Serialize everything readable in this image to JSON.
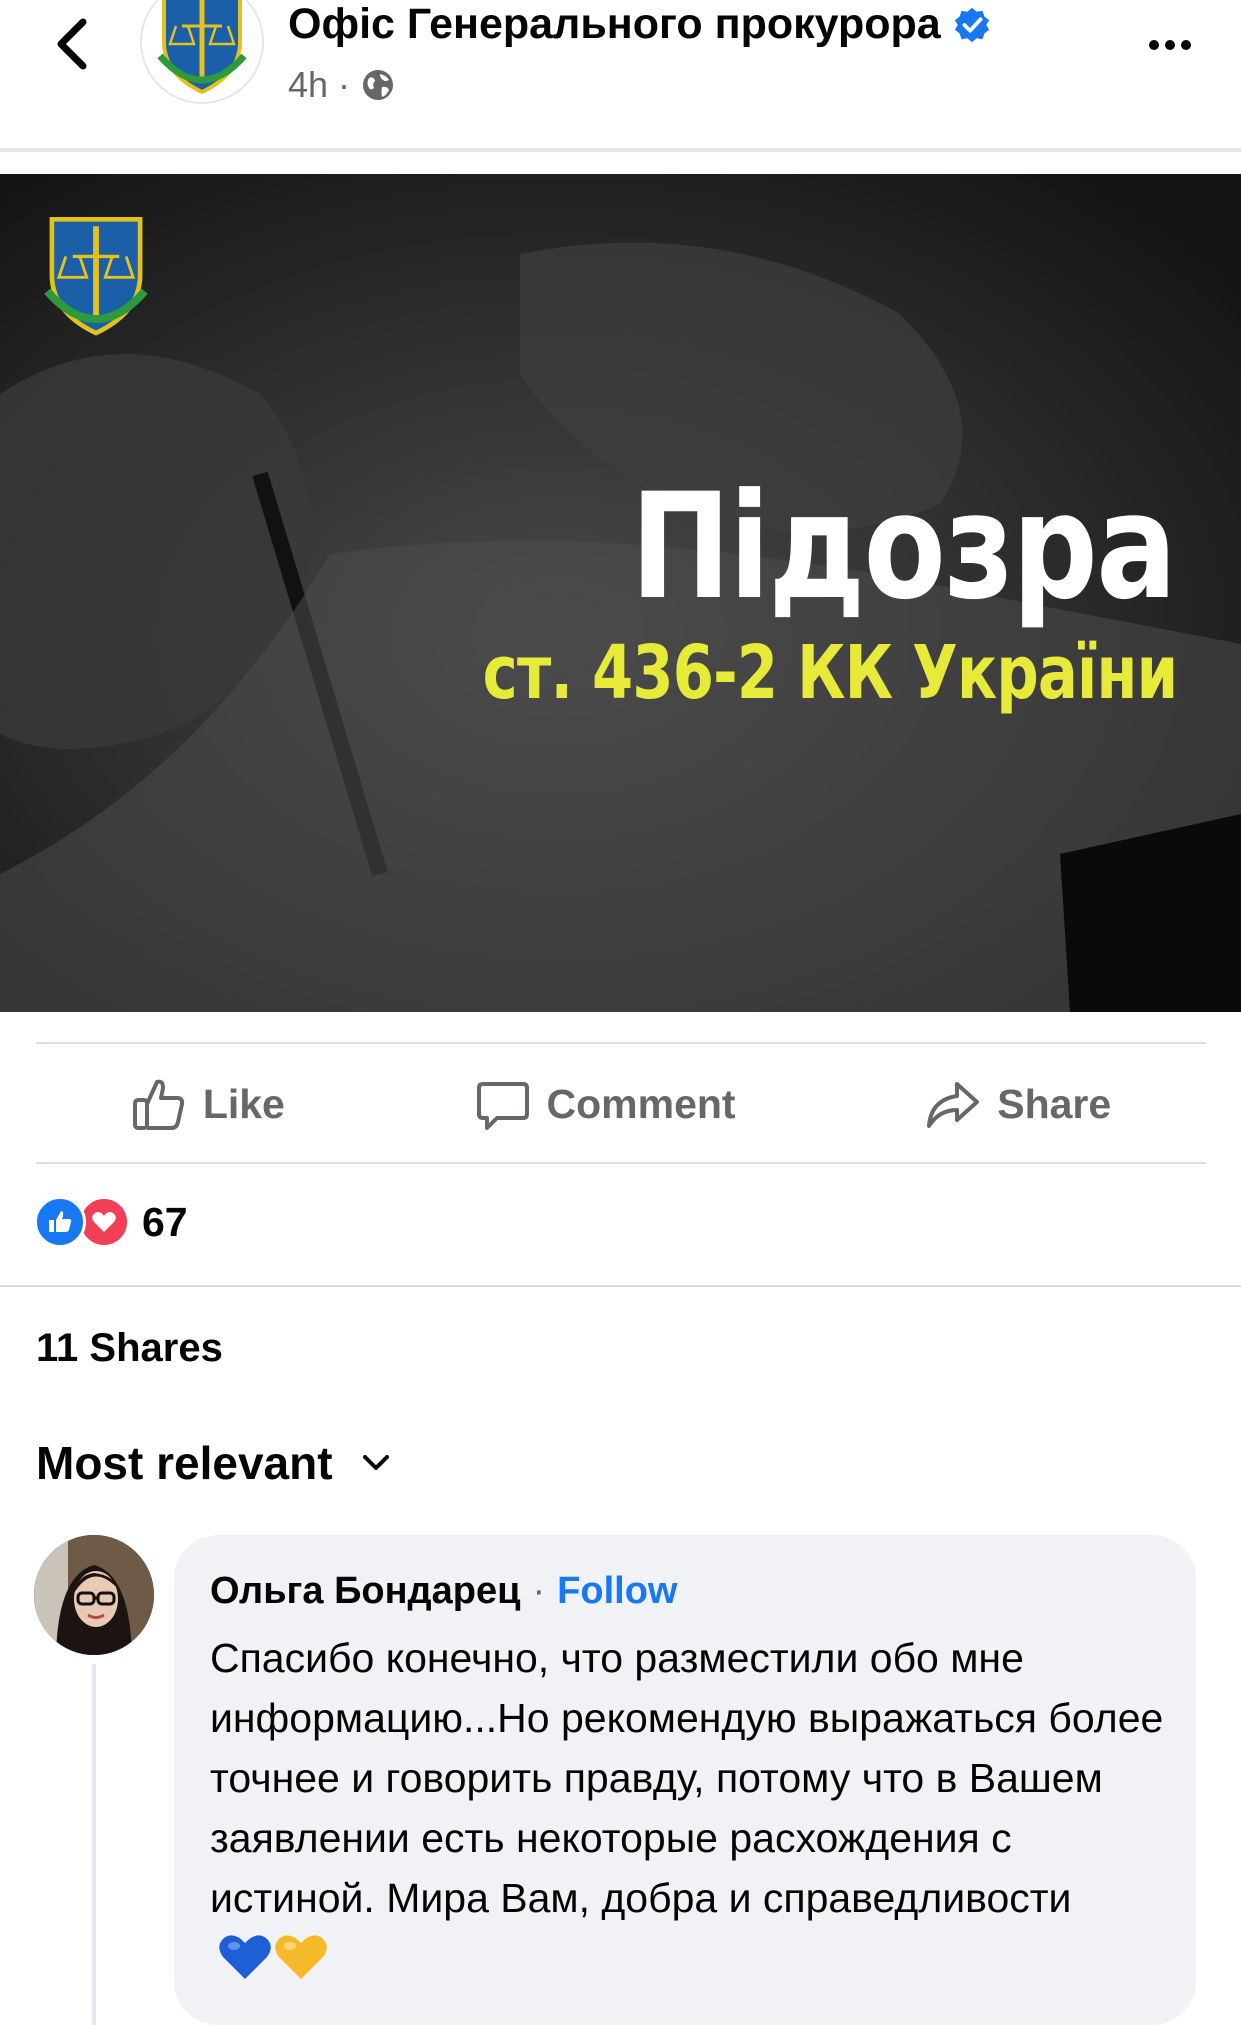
{
  "header": {
    "page_name": "Офіс Генерального прокурора",
    "time": "4h",
    "separator": "·",
    "icons": {
      "back": "chevron-left-icon",
      "verified": "verified-badge-icon",
      "audience": "globe-icon",
      "more": "more-horizontal-icon"
    }
  },
  "post_image": {
    "headline": "Підозра",
    "subline": "ст. 436-2 КК України",
    "colors": {
      "headline": "#ffffff",
      "subline": "#e8ea3a",
      "background": "#1c1c1c"
    }
  },
  "actions": {
    "like": "Like",
    "comment": "Comment",
    "share": "Share"
  },
  "reactions": {
    "count": "67",
    "types": [
      "like",
      "love"
    ]
  },
  "shares": "11 Shares",
  "sort": {
    "label": "Most relevant"
  },
  "comment": {
    "author": "Ольга Бондарец",
    "separator": "·",
    "follow": "Follow",
    "text": "Спасибо конечно, что разместили обо мне информацию...Но рекомендую выражаться более точнее и говорить правду, потому что в Вашем заявлении есть некоторые расхождения с истиной. Мира Вам, добра и справедливости",
    "emoji": [
      "blue-heart",
      "yellow-heart"
    ]
  },
  "colors": {
    "accent": "#1877f2",
    "secondary_text": "#65676b",
    "divider": "#dadde1"
  }
}
